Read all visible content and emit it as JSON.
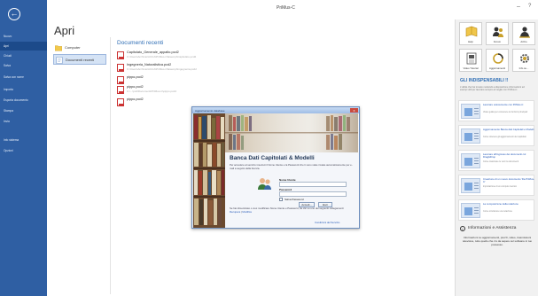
{
  "app": {
    "title": "PriMus-C"
  },
  "window": {
    "minimize": "–",
    "help": "?"
  },
  "leftnav": {
    "items": [
      {
        "label": "Nuovo"
      },
      {
        "label": "Apri"
      },
      {
        "label": "Chiudi"
      },
      {
        "label": "Salva"
      },
      {
        "label": "Salva con nome"
      },
      {
        "label": "Importa"
      },
      {
        "label": "Esporta documento"
      },
      {
        "label": "Stampa"
      },
      {
        "label": "Invia"
      },
      {
        "label": "Info sistema"
      },
      {
        "label": "Opzioni"
      }
    ]
  },
  "main": {
    "title": "Apri",
    "places": [
      {
        "label": "Computer"
      },
      {
        "label": "Documenti recenti"
      }
    ],
    "recent_title": "Documenti recenti",
    "recent": [
      {
        "name": "Capitolato_Generale_appalto.pcd2",
        "path": "C:\\Users\\Archivio\\ACCA\\PriMus-C\\Esempi\\Capitolato.pcd2"
      },
      {
        "name": "Ingegneria_Naturalistica.pcd2",
        "path": "C:\\Users\\Archivio\\ACCA\\PriMus-C\\Esempi\\Ingegneria.pcd2"
      },
      {
        "name": "pippo.pcd2",
        "path": ""
      },
      {
        "name": "pippo.pcd2",
        "path": "C:\\...\\pcd\\Documenti\\PriMus-C\\pippo.pcd2"
      },
      {
        "name": "pippo.pcd2",
        "path": ""
      }
    ]
  },
  "dialog": {
    "title": "Aggiornamento database",
    "close": "x",
    "heading": "Banca Dati Capitolati & Modelli",
    "description": "Per accedere al servizio inserisci il Nome Utente e la Password che ti sono state inviate automaticamente per e-mail a seguito della licenza.",
    "username_label": "Nome Utente",
    "password_label": "Password",
    "remember_label": "Salva Password",
    "btn_primary": "Accedi...",
    "btn_secondary": "Esci",
    "foot_text": "Se hai dimenticato o vuoi modificare Nome Utente e Password, fai clic su uno dei seguenti collegamenti:",
    "link_recover": "Recupera",
    "link_sep": " | ",
    "link_modify": "Modifica",
    "link_terms": "Condizioni del Servizio"
  },
  "rightpane": {
    "tiles": [
      {
        "label": "Help",
        "icon": "help-book-icon"
      },
      {
        "label": "Forum",
        "icon": "users-icon"
      },
      {
        "label": "ArtCo",
        "icon": "person-icon"
      },
      {
        "label": "Video Tutorial",
        "icon": "video-icon"
      },
      {
        "label": "Aggiornamenti",
        "icon": "update-icon"
      },
      {
        "label": "Info su...",
        "icon": "gear-icon"
      }
    ],
    "gli_title": "GLI INDISPENSABILI !!",
    "gli_desc": "L'utilità che hai trovato mettendo a disposizione informazioni ed esempi utili per lavorare sempre al meglio con PriMus-C.",
    "gli_items": [
      {
        "title": "Lavorare velocemente con PriMus-C",
        "desc": "Video guida per conoscere le funzioni principali"
      },
      {
        "title": "Aggiornamento Banca dati Capitolati e Modelli",
        "desc": "Come ottenere gli aggiornamenti dei capitolati"
      },
      {
        "title": "Lavorare all'ingrosso dei documenti col Drag&Drop",
        "desc": "Come trascinare le voci tra documenti"
      },
      {
        "title": "Creazione di un nuovo documento 'Da PriMus-C'",
        "desc": "Importazione di un computo metrico"
      },
      {
        "title": "La composizione della relazione",
        "desc": "Come strutturare una relazione"
      }
    ],
    "info_title": "Informazioni e Assistenza",
    "info_desc": "Informazioni su aggiornamenti, prezzi, video, trasmissioni televisive, tutto quello che c'è da sapere sul software in tuo possesso."
  },
  "colors": {
    "nav": "#2f5fa3",
    "accent": "#2f6eb5"
  }
}
